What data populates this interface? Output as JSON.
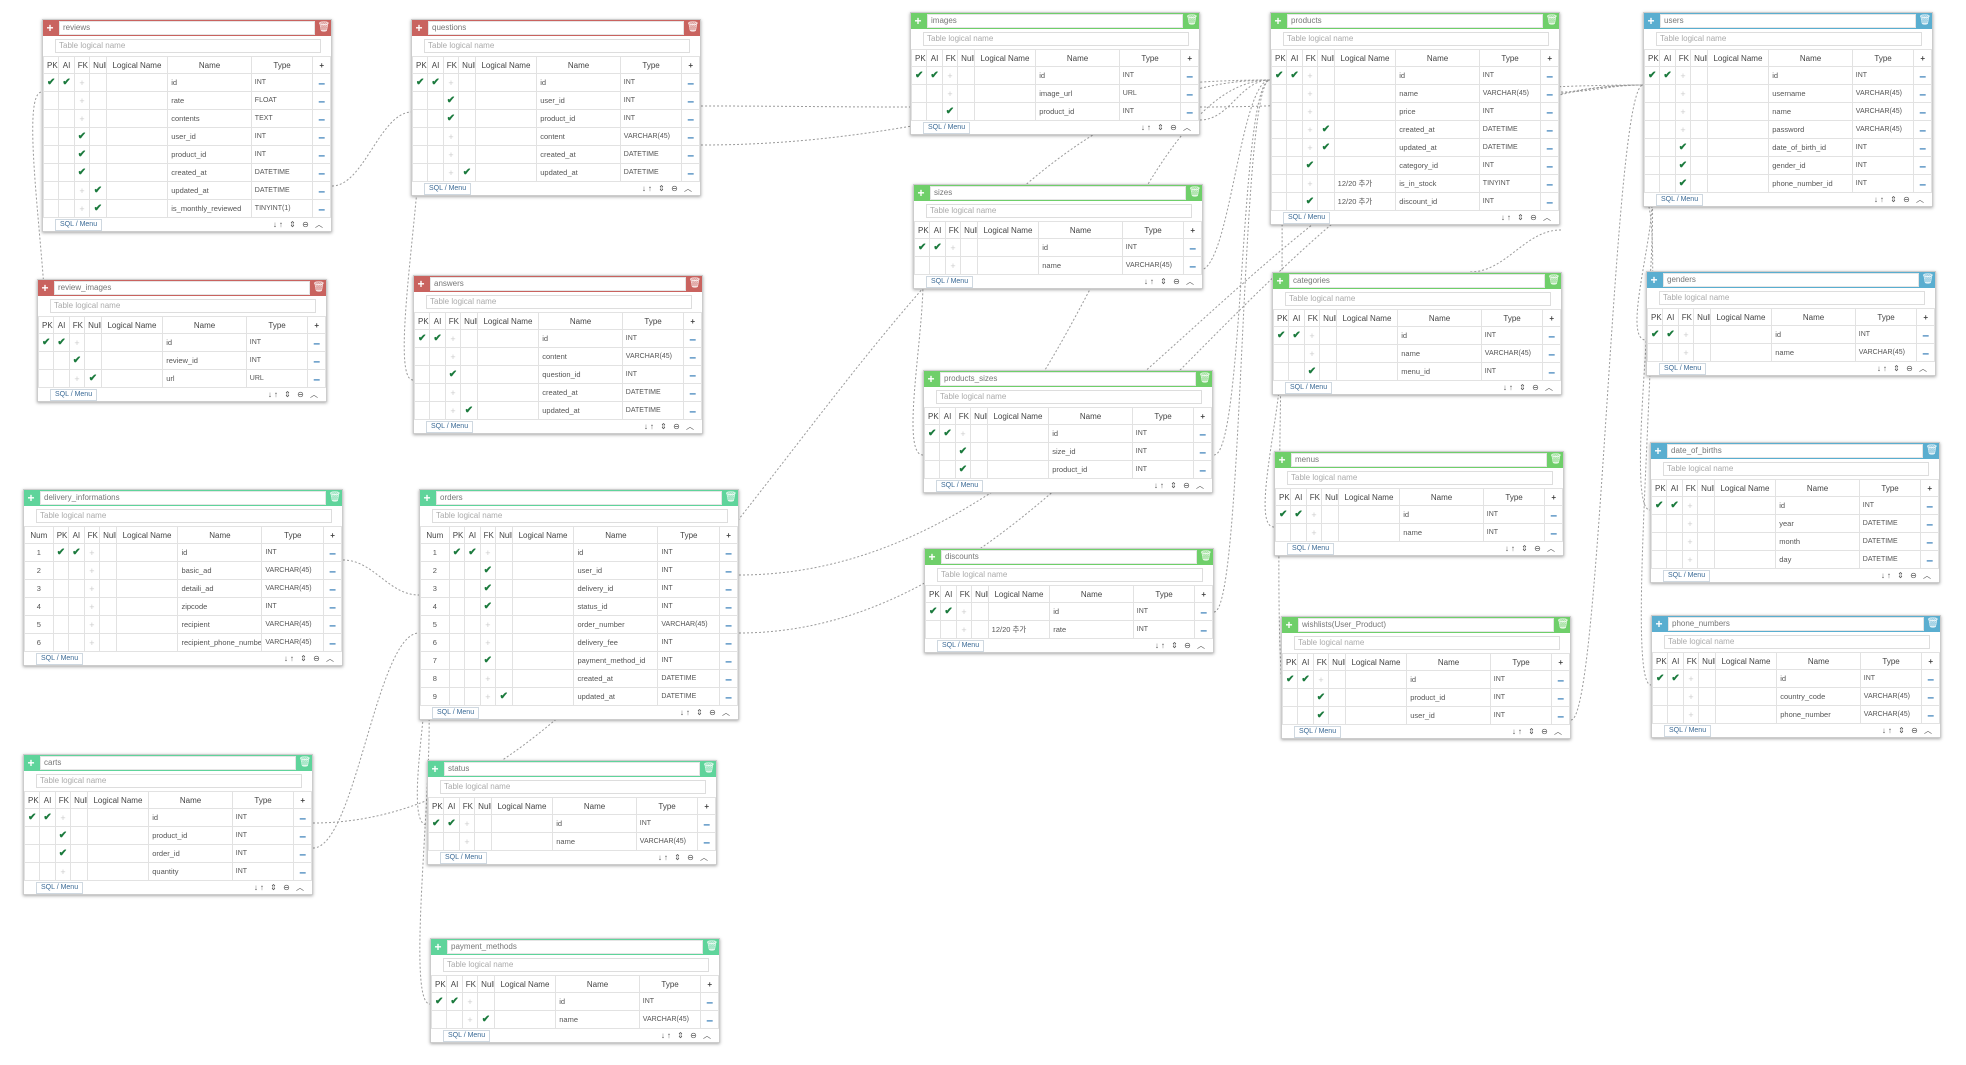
{
  "ui": {
    "logical_placeholder": "Table logical name",
    "sql_menu": "SQL / Menu",
    "footer_icons": "↓↑ ⇕ ⊖ ︿",
    "col_headers": [
      "PK",
      "AI",
      "FK",
      "Null",
      "Logical Name",
      "Name",
      "Type"
    ],
    "num_header": "Num"
  },
  "colors": {
    "red": "#c9635f",
    "green": "#6fcf6a",
    "teal": "#5fd49b",
    "blue": "#5aaed0"
  },
  "tables": [
    {
      "id": "reviews",
      "name": "reviews",
      "color": "red",
      "numbered": false,
      "rows": [
        [
          "✔",
          "✔",
          "+",
          "",
          "",
          "id",
          "INT"
        ],
        [
          "",
          "",
          "+",
          "",
          "",
          "rate",
          "FLOAT"
        ],
        [
          "",
          "",
          "+",
          "",
          "",
          "contents",
          "TEXT"
        ],
        [
          "",
          "",
          "✔",
          "",
          "",
          "user_id",
          "INT"
        ],
        [
          "",
          "",
          "✔",
          "",
          "",
          "product_id",
          "INT"
        ],
        [
          "",
          "",
          "✔",
          "",
          "",
          "created_at",
          "DATETIME"
        ],
        [
          "",
          "",
          "+",
          "✔",
          "",
          "updated_at",
          "DATETIME"
        ],
        [
          "",
          "",
          "+",
          "✔",
          "",
          "is_monthly_reviewed",
          "TINYINT(1)"
        ]
      ]
    },
    {
      "id": "review_images",
      "name": "review_images",
      "color": "red",
      "numbered": false,
      "rows": [
        [
          "✔",
          "✔",
          "+",
          "",
          "",
          "id",
          "INT"
        ],
        [
          "",
          "",
          "✔",
          "",
          "",
          "review_id",
          "INT"
        ],
        [
          "",
          "",
          "+",
          "✔",
          "",
          "url",
          "URL"
        ]
      ]
    },
    {
      "id": "questions",
      "name": "questions",
      "color": "red",
      "numbered": false,
      "rows": [
        [
          "✔",
          "✔",
          "+",
          "",
          "",
          "id",
          "INT"
        ],
        [
          "",
          "",
          "✔",
          "",
          "",
          "user_id",
          "INT"
        ],
        [
          "",
          "",
          "✔",
          "",
          "",
          "product_id",
          "INT"
        ],
        [
          "",
          "",
          "+",
          "",
          "",
          "content",
          "VARCHAR(45)"
        ],
        [
          "",
          "",
          "+",
          "",
          "",
          "created_at",
          "DATETIME"
        ],
        [
          "",
          "",
          "+",
          "✔",
          "",
          "updated_at",
          "DATETIME"
        ]
      ]
    },
    {
      "id": "answers",
      "name": "answers",
      "color": "red",
      "numbered": false,
      "rows": [
        [
          "✔",
          "✔",
          "+",
          "",
          "",
          "id",
          "INT"
        ],
        [
          "",
          "",
          "+",
          "",
          "",
          "content",
          "VARCHAR(45)"
        ],
        [
          "",
          "",
          "✔",
          "",
          "",
          "question_id",
          "INT"
        ],
        [
          "",
          "",
          "+",
          "",
          "",
          "created_at",
          "DATETIME"
        ],
        [
          "",
          "",
          "+",
          "✔",
          "",
          "updated_at",
          "DATETIME"
        ]
      ]
    },
    {
      "id": "images",
      "name": "images",
      "color": "green",
      "numbered": false,
      "rows": [
        [
          "✔",
          "✔",
          "+",
          "",
          "",
          "id",
          "INT"
        ],
        [
          "",
          "",
          "+",
          "",
          "",
          "image_url",
          "URL"
        ],
        [
          "",
          "",
          "✔",
          "",
          "",
          "product_id",
          "INT"
        ]
      ]
    },
    {
      "id": "sizes",
      "name": "sizes",
      "color": "green",
      "numbered": false,
      "rows": [
        [
          "✔",
          "✔",
          "+",
          "",
          "",
          "id",
          "INT"
        ],
        [
          "",
          "",
          "+",
          "",
          "",
          "name",
          "VARCHAR(45)"
        ]
      ]
    },
    {
      "id": "products_sizes",
      "name": "products_sizes",
      "color": "green",
      "numbered": false,
      "rows": [
        [
          "✔",
          "✔",
          "+",
          "",
          "",
          "id",
          "INT"
        ],
        [
          "",
          "",
          "✔",
          "",
          "",
          "size_id",
          "INT"
        ],
        [
          "",
          "",
          "✔",
          "",
          "",
          "product_id",
          "INT"
        ]
      ]
    },
    {
      "id": "discounts",
      "name": "discounts",
      "color": "green",
      "numbered": false,
      "rows": [
        [
          "✔",
          "✔",
          "+",
          "",
          "",
          "id",
          "INT"
        ],
        [
          "",
          "",
          "+",
          "",
          "12/20 추가",
          "rate",
          "INT"
        ]
      ]
    },
    {
      "id": "products",
      "name": "products",
      "color": "green",
      "numbered": false,
      "rows": [
        [
          "✔",
          "✔",
          "+",
          "",
          "",
          "id",
          "INT"
        ],
        [
          "",
          "",
          "+",
          "",
          "",
          "name",
          "VARCHAR(45)"
        ],
        [
          "",
          "",
          "+",
          "",
          "",
          "price",
          "INT"
        ],
        [
          "",
          "",
          "+",
          "✔",
          "",
          "created_at",
          "DATETIME"
        ],
        [
          "",
          "",
          "+",
          "✔",
          "",
          "updated_at",
          "DATETIME"
        ],
        [
          "",
          "",
          "✔",
          "",
          "",
          "category_id",
          "INT"
        ],
        [
          "",
          "",
          "+",
          "",
          "12/20 추가",
          "is_in_stock",
          "TINYINT"
        ],
        [
          "",
          "",
          "✔",
          "",
          "12/20 추가",
          "discount_id",
          "INT"
        ]
      ]
    },
    {
      "id": "categories",
      "name": "categories",
      "color": "green",
      "numbered": false,
      "rows": [
        [
          "✔",
          "✔",
          "+",
          "",
          "",
          "id",
          "INT"
        ],
        [
          "",
          "",
          "+",
          "",
          "",
          "name",
          "VARCHAR(45)"
        ],
        [
          "",
          "",
          "✔",
          "",
          "",
          "menu_id",
          "INT"
        ]
      ]
    },
    {
      "id": "menus",
      "name": "menus",
      "color": "green",
      "numbered": false,
      "rows": [
        [
          "✔",
          "✔",
          "+",
          "",
          "",
          "id",
          "INT"
        ],
        [
          "",
          "",
          "+",
          "",
          "",
          "name",
          "INT"
        ]
      ]
    },
    {
      "id": "wishlists",
      "name": "wishlists(User_Product)",
      "color": "green",
      "numbered": false,
      "rows": [
        [
          "✔",
          "✔",
          "+",
          "",
          "",
          "id",
          "INT"
        ],
        [
          "",
          "",
          "✔",
          "",
          "",
          "product_id",
          "INT"
        ],
        [
          "",
          "",
          "✔",
          "",
          "",
          "user_id",
          "INT"
        ]
      ]
    },
    {
      "id": "users",
      "name": "users",
      "color": "blue",
      "numbered": false,
      "rows": [
        [
          "✔",
          "✔",
          "+",
          "",
          "",
          "id",
          "INT"
        ],
        [
          "",
          "",
          "+",
          "",
          "",
          "username",
          "VARCHAR(45)"
        ],
        [
          "",
          "",
          "+",
          "",
          "",
          "name",
          "VARCHAR(45)"
        ],
        [
          "",
          "",
          "+",
          "",
          "",
          "password",
          "VARCHAR(45)"
        ],
        [
          "",
          "",
          "✔",
          "",
          "",
          "date_of_birth_id",
          "INT"
        ],
        [
          "",
          "",
          "✔",
          "",
          "",
          "gender_id",
          "INT"
        ],
        [
          "",
          "",
          "✔",
          "",
          "",
          "phone_number_id",
          "INT"
        ]
      ]
    },
    {
      "id": "genders",
      "name": "genders",
      "color": "blue",
      "numbered": false,
      "rows": [
        [
          "✔",
          "✔",
          "+",
          "",
          "",
          "id",
          "INT"
        ],
        [
          "",
          "",
          "+",
          "",
          "",
          "name",
          "VARCHAR(45)"
        ]
      ]
    },
    {
      "id": "date_of_births",
      "name": "date_of_births",
      "color": "blue",
      "numbered": false,
      "rows": [
        [
          "✔",
          "✔",
          "+",
          "",
          "",
          "id",
          "INT"
        ],
        [
          "",
          "",
          "+",
          "",
          "",
          "year",
          "DATETIME"
        ],
        [
          "",
          "",
          "+",
          "",
          "",
          "month",
          "DATETIME"
        ],
        [
          "",
          "",
          "+",
          "",
          "",
          "day",
          "DATETIME"
        ]
      ]
    },
    {
      "id": "phone_numbers",
      "name": "phone_numbers",
      "color": "blue",
      "numbered": false,
      "rows": [
        [
          "✔",
          "✔",
          "+",
          "",
          "",
          "id",
          "INT"
        ],
        [
          "",
          "",
          "+",
          "",
          "",
          "country_code",
          "VARCHAR(45)"
        ],
        [
          "",
          "",
          "+",
          "",
          "",
          "phone_number",
          "VARCHAR(45)"
        ]
      ]
    },
    {
      "id": "delivery_informations",
      "name": "delivery_informations",
      "color": "teal",
      "numbered": true,
      "rows": [
        [
          "1",
          "✔",
          "✔",
          "+",
          "",
          "",
          "id",
          "INT"
        ],
        [
          "2",
          "",
          "",
          "+",
          "",
          "",
          "basic_ad",
          "VARCHAR(45)"
        ],
        [
          "3",
          "",
          "",
          "+",
          "",
          "",
          "detaili_ad",
          "VARCHAR(45)"
        ],
        [
          "4",
          "",
          "",
          "+",
          "",
          "",
          "zipcode",
          "INT"
        ],
        [
          "5",
          "",
          "",
          "+",
          "",
          "",
          "recipient",
          "VARCHAR(45)"
        ],
        [
          "6",
          "",
          "",
          "+",
          "",
          "",
          "recipient_phone_number",
          "VARCHAR(45)"
        ]
      ]
    },
    {
      "id": "orders",
      "name": "orders",
      "color": "teal",
      "numbered": true,
      "rows": [
        [
          "1",
          "✔",
          "✔",
          "+",
          "",
          "",
          "id",
          "INT"
        ],
        [
          "2",
          "",
          "",
          "✔",
          "",
          "",
          "user_id",
          "INT"
        ],
        [
          "3",
          "",
          "",
          "✔",
          "",
          "",
          "delivery_id",
          "INT"
        ],
        [
          "4",
          "",
          "",
          "✔",
          "",
          "",
          "status_id",
          "INT"
        ],
        [
          "5",
          "",
          "",
          "+",
          "",
          "",
          "order_number",
          "VARCHAR(45)"
        ],
        [
          "6",
          "",
          "",
          "+",
          "",
          "",
          "delivery_fee",
          "INT"
        ],
        [
          "7",
          "",
          "",
          "✔",
          "",
          "",
          "payment_method_id",
          "INT"
        ],
        [
          "8",
          "",
          "",
          "+",
          "",
          "",
          "created_at",
          "DATETIME"
        ],
        [
          "9",
          "",
          "",
          "+",
          "✔",
          "",
          "updated_at",
          "DATETIME"
        ]
      ]
    },
    {
      "id": "carts",
      "name": "carts",
      "color": "teal",
      "numbered": false,
      "rows": [
        [
          "✔",
          "✔",
          "+",
          "",
          "",
          "id",
          "INT"
        ],
        [
          "",
          "",
          "✔",
          "",
          "",
          "product_id",
          "INT"
        ],
        [
          "",
          "",
          "✔",
          "",
          "",
          "order_id",
          "INT"
        ],
        [
          "",
          "",
          "+",
          "",
          "",
          "quantity",
          "INT"
        ]
      ]
    },
    {
      "id": "status",
      "name": "status",
      "color": "teal",
      "numbered": false,
      "rows": [
        [
          "✔",
          "✔",
          "+",
          "",
          "",
          "id",
          "INT"
        ],
        [
          "",
          "",
          "+",
          "",
          "",
          "name",
          "VARCHAR(45)"
        ]
      ]
    },
    {
      "id": "payment_methods",
      "name": "payment_methods",
      "color": "teal",
      "numbered": false,
      "rows": [
        [
          "✔",
          "✔",
          "+",
          "",
          "",
          "id",
          "INT"
        ],
        [
          "",
          "",
          "+",
          "✔",
          "",
          "name",
          "VARCHAR(45)"
        ]
      ]
    }
  ]
}
